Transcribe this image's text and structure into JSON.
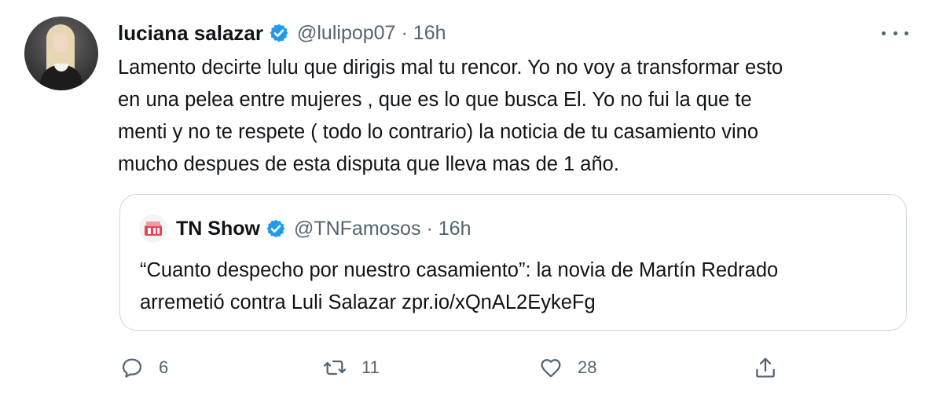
{
  "tweet": {
    "author_name": "luciana salazar",
    "author_handle": "@lulipop07",
    "separator": "·",
    "time": "16h",
    "text": "Lamento decirte lulu que dirigis mal tu rencor. Yo no voy a transformar esto\nen una pelea entre mujeres , que es lo que busca El. Yo no fui la que te\nmenti y no te respete ( todo lo contrario) la noticia de tu casamiento vino\nmucho despues de esta disputa que lleva mas de 1 año."
  },
  "quoted": {
    "author_name": "TN Show",
    "author_handle": "@TNFamosos",
    "separator": "·",
    "time": "16h",
    "text": "“Cuanto despecho por nuestro casamiento”: la novia de Martín Redrado\narremetió contra Luli Salazar zpr.io/xQnAL2EykeFg"
  },
  "actions": {
    "replies": "6",
    "retweets": "11",
    "likes": "28"
  },
  "icons": [
    "verified-badge-icon",
    "more-options-icon",
    "reply-icon",
    "retweet-icon",
    "like-icon",
    "share-icon",
    "tn-logo-icon"
  ],
  "colors": {
    "verified": "#1d9bf0",
    "secondary_text": "#536471",
    "border": "#cfd9de",
    "tn_logo": "#e8414f"
  }
}
